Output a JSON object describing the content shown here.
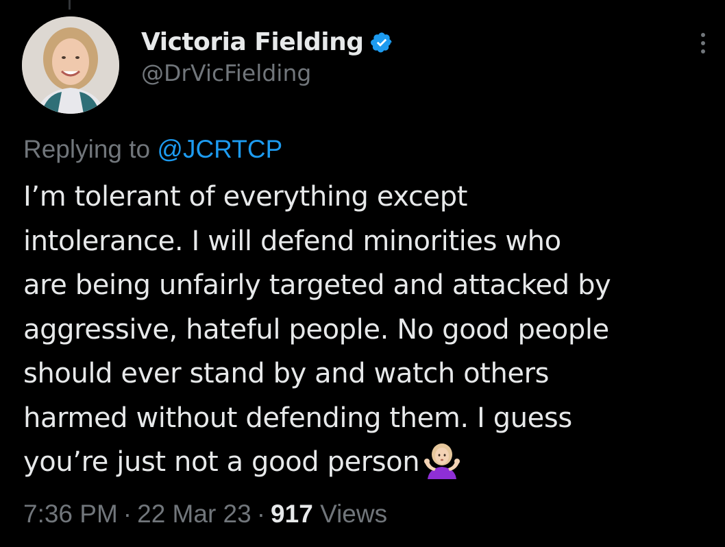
{
  "author": {
    "display_name": "Victoria Fielding",
    "handle": "@DrVicFielding",
    "verified": true,
    "avatar_icon": "user-avatar-photo"
  },
  "reply": {
    "prefix": "Replying to ",
    "mention": "@JCRTCP"
  },
  "tweet": {
    "lines": [
      "I’m tolerant of everything except",
      "intolerance. I will defend minorities who",
      "are being unfairly targeted and attacked by",
      "aggressive, hateful people. No good people",
      "should ever stand by and watch others",
      "harmed without defending them. I guess",
      "you’re just not a good person"
    ],
    "emoji": "person-shrugging-emoji"
  },
  "meta": {
    "time": "7:36 PM",
    "separator": "·",
    "date": "22 Mar 23",
    "views_count": "917",
    "views_label": "Views"
  },
  "icons": {
    "verified": "verified-badge-icon",
    "more": "more-options-icon"
  },
  "colors": {
    "background": "#000000",
    "primary_text": "#e7e9ea",
    "secondary_text": "#71767b",
    "accent": "#1d9bf0"
  }
}
